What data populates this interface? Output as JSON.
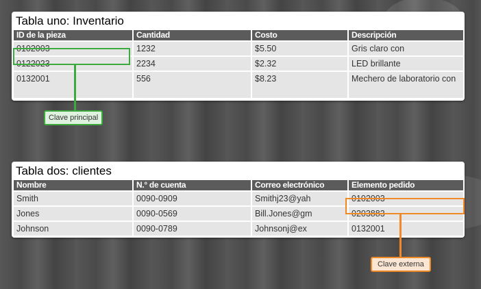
{
  "table1": {
    "title": "Tabla uno: Inventario",
    "headers": [
      "ID de la pieza",
      "Cantidad",
      "Costo",
      "Descripción"
    ],
    "rows": [
      [
        "0102003",
        "1232",
        "$5.50",
        "Gris claro con"
      ],
      [
        "0122023",
        "2234",
        "$2.32",
        "LED brillante"
      ],
      [
        "0132001",
        "556",
        "$8.23",
        "Mechero de laboratorio con"
      ]
    ]
  },
  "table2": {
    "title": "Tabla dos: clientes",
    "headers": [
      "Nombre",
      "N.° de cuenta",
      "Correo electrónico",
      "Elemento pedido"
    ],
    "rows": [
      [
        "Smith",
        "0090-0909",
        "Smithj23@yah",
        "0102003"
      ],
      [
        "Jones",
        "0090-0569",
        "Bill.Jones@gm",
        "0203883"
      ],
      [
        "Johnson",
        "0090-0789",
        "Johnsonj@ex",
        "0132001"
      ]
    ]
  },
  "callouts": {
    "primary_key": "Clave principal",
    "foreign_key": "Clave externa"
  },
  "colors": {
    "primary_key": "#3daa3d",
    "foreign_key": "#ef8a27",
    "header_bg": "#5b5b5b",
    "cell_bg": "#e6e5e5"
  }
}
